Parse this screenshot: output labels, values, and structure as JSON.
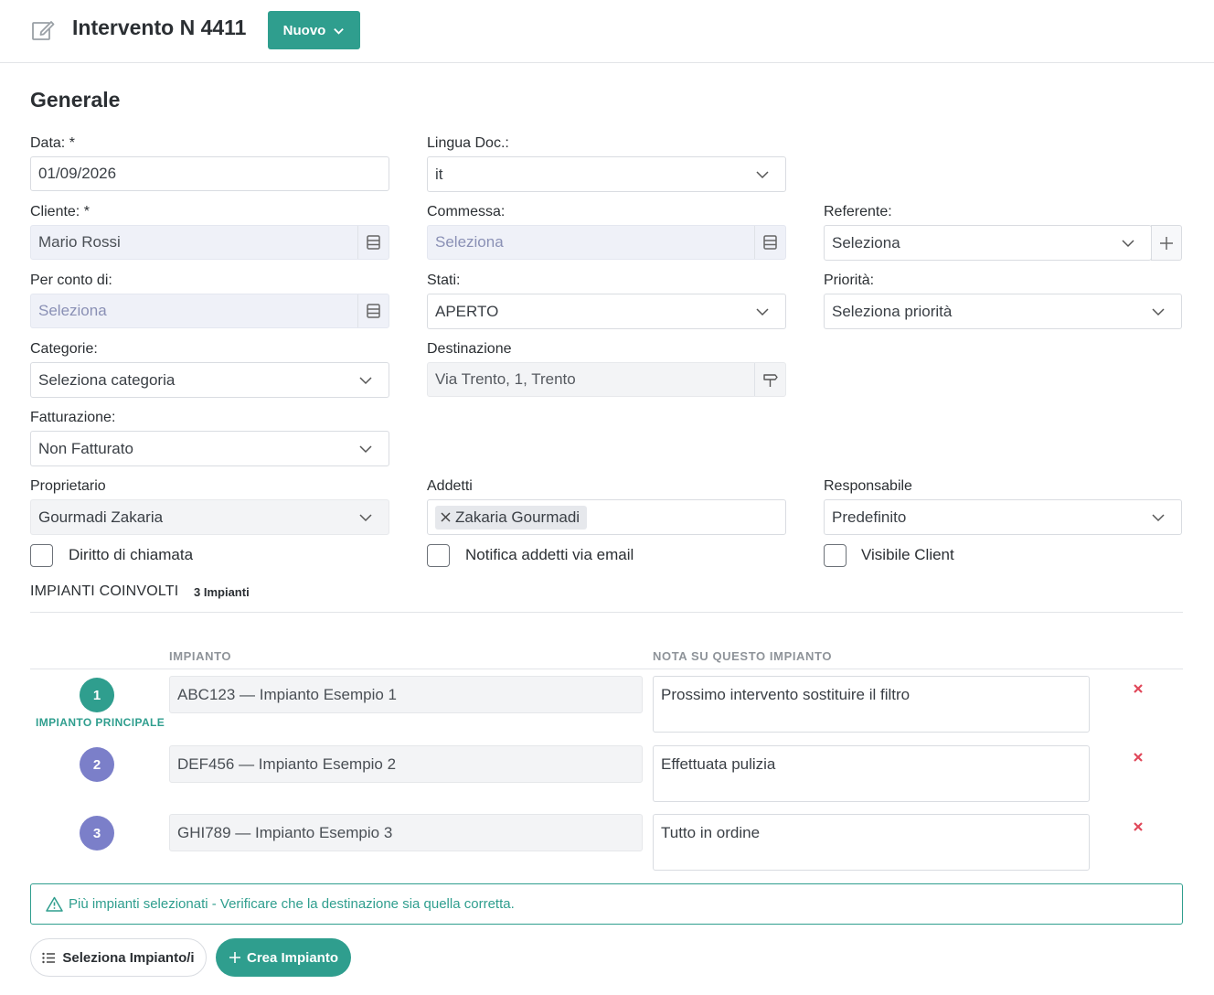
{
  "header": {
    "title": "Intervento N 4411",
    "new_button_label": "Nuovo"
  },
  "section": {
    "title": "Generale"
  },
  "fields": {
    "data": {
      "label": "Data: *",
      "value": "01/09/2026"
    },
    "lingua": {
      "label": "Lingua Doc.:",
      "value": "it"
    },
    "cliente": {
      "label": "Cliente: *",
      "value": "Mario Rossi"
    },
    "commessa": {
      "label": "Commessa:",
      "placeholder": "Seleziona"
    },
    "referente": {
      "label": "Referente:",
      "value": "Seleziona"
    },
    "per_conto": {
      "label": "Per conto di:",
      "placeholder": "Seleziona"
    },
    "stati": {
      "label": "Stati:",
      "value": "APERTO"
    },
    "priorita": {
      "label": "Priorità:",
      "value": "Seleziona priorità"
    },
    "categorie": {
      "label": "Categorie:",
      "value": "Seleziona categoria"
    },
    "destinazione": {
      "label": "Destinazione",
      "value": "Via Trento, 1, Trento"
    },
    "fatturazione": {
      "label": "Fatturazione:",
      "value": "Non Fatturato"
    },
    "proprietario": {
      "label": "Proprietario",
      "value": "Gourmadi Zakaria"
    },
    "addetti": {
      "label": "Addetti",
      "tags": [
        "Zakaria Gourmadi"
      ]
    },
    "responsabile": {
      "label": "Responsabile",
      "value": "Predefinito"
    }
  },
  "checkboxes": {
    "diritto": {
      "label": "Diritto di chiamata",
      "checked": false
    },
    "notifica": {
      "label": "Notifica addetti via email",
      "checked": false
    },
    "visibile": {
      "label": "Visibile Client",
      "checked": false
    }
  },
  "impianti": {
    "heading": "IMPIANTI COINVOLTI",
    "count_label": "3 Impianti",
    "col_impianto": "IMPIANTO",
    "col_nota": "NOTA SU QUESTO IMPIANTO",
    "principale_label": "IMPIANTO PRINCIPALE",
    "rows": [
      {
        "num": "1",
        "impianto": "ABC123 — Impianto Esempio 1",
        "nota": "Prossimo intervento sostituire il filtro"
      },
      {
        "num": "2",
        "impianto": "DEF456 — Impianto Esempio 2",
        "nota": "Effettuata pulizia"
      },
      {
        "num": "3",
        "impianto": "GHI789 — Impianto Esempio 3",
        "nota": "Tutto in ordine"
      }
    ]
  },
  "alert": {
    "text": "Più impianti selezionati - Verificare che la destinazione sia quella corretta."
  },
  "actions": {
    "seleziona_label": "Seleziona Impianto/i",
    "crea_label": "Crea Impianto"
  },
  "colors": {
    "accent": "#2f9e8e",
    "secondary_badge": "#7b7fc9",
    "danger": "#e0485a"
  },
  "icons": {
    "header": "edit-icon",
    "dropdown": "chevron-down-icon",
    "lookup": "list-box-icon",
    "add": "plus-icon",
    "destination": "signpost-icon",
    "remove_tag": "close-icon",
    "delete_row": "delete-x-icon",
    "warning": "warning-icon",
    "list": "list-icon"
  }
}
